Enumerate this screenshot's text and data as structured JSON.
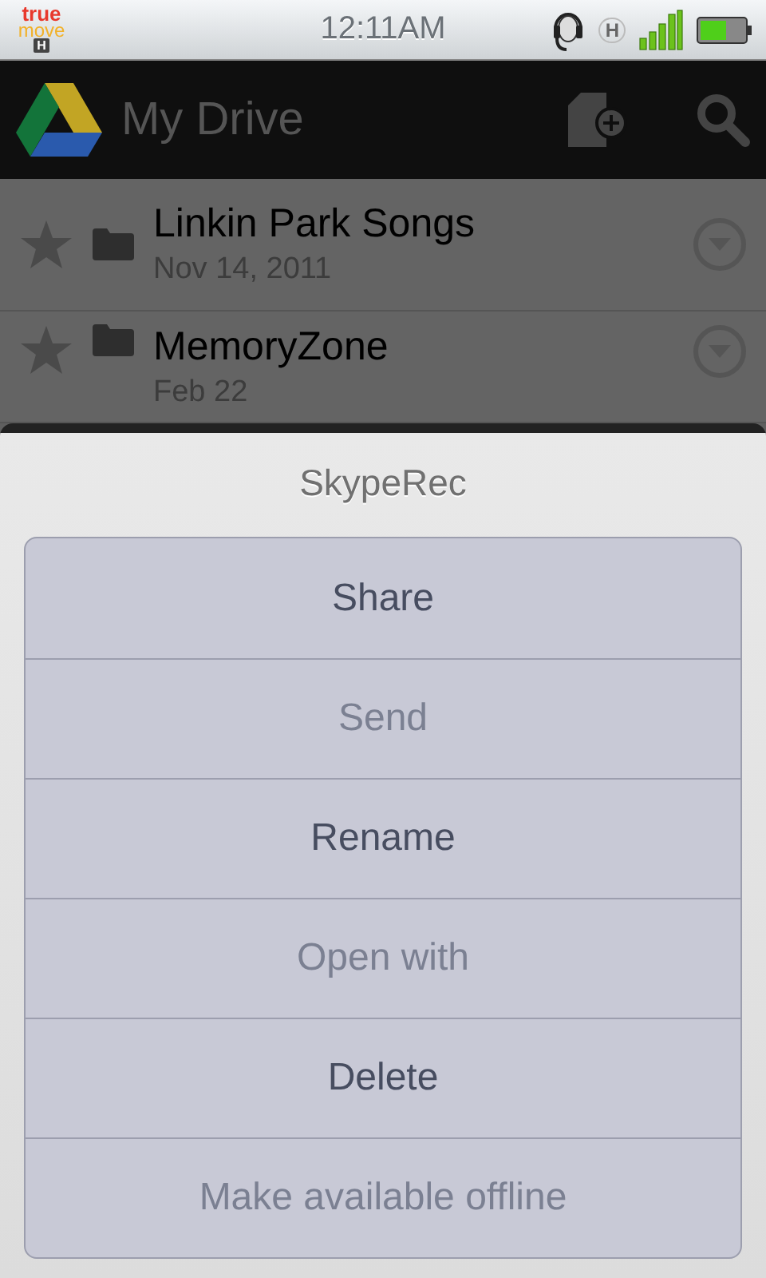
{
  "status_bar": {
    "carrier_top": "true",
    "carrier_bottom": "move",
    "network_badge": "H",
    "time": "12:11AM",
    "data_indicator": "H"
  },
  "action_bar": {
    "title": "My Drive"
  },
  "files": [
    {
      "name": "Linkin Park Songs",
      "date": "Nov 14, 2011"
    },
    {
      "name": "MemoryZone",
      "date": "Feb 22"
    }
  ],
  "dialog": {
    "title": "SkypeRec",
    "items": [
      {
        "label": "Share",
        "disabled": false
      },
      {
        "label": "Send",
        "disabled": true
      },
      {
        "label": "Rename",
        "disabled": false
      },
      {
        "label": "Open with",
        "disabled": true
      },
      {
        "label": "Delete",
        "disabled": false
      },
      {
        "label": "Make available offline",
        "disabled": true
      }
    ]
  }
}
